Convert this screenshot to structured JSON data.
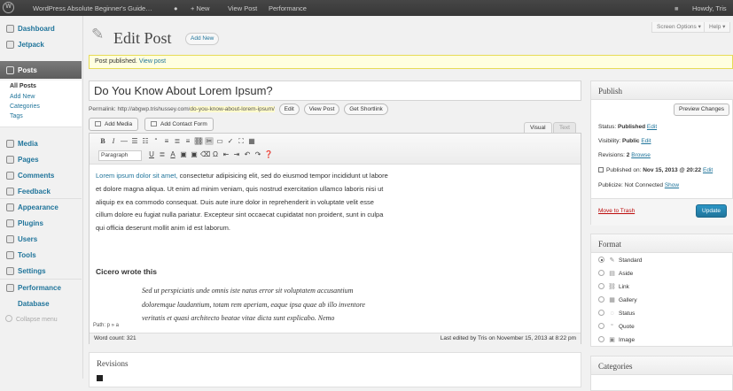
{
  "admin_bar": {
    "site_name": "WordPress Absolute Beginner's Guide…",
    "comment_icon": "speech-bubble-icon",
    "new_label": "+ New",
    "view_post": "View Post",
    "performance": "Performance",
    "howdy": "Howdy, Tris"
  },
  "sidebar": {
    "dashboard": "Dashboard",
    "jetpack": "Jetpack",
    "posts": "Posts",
    "sub": {
      "all_posts": "All Posts",
      "add_new": "Add New",
      "categories": "Categories",
      "tags": "Tags"
    },
    "media": "Media",
    "pages": "Pages",
    "comments": "Comments",
    "feedback": "Feedback",
    "appearance": "Appearance",
    "plugins": "Plugins",
    "users": "Users",
    "tools": "Tools",
    "settings": "Settings",
    "performance": "Performance",
    "database": "Database",
    "collapse": "Collapse menu"
  },
  "header": {
    "title": "Edit Post",
    "add_new": "Add New",
    "screen_options": "Screen Options ▾",
    "help": "Help ▾"
  },
  "notice": {
    "text": "Post published.",
    "link": "View post"
  },
  "post": {
    "title": "Do You Know About Lorem Ipsum?",
    "permalink_label": "Permalink:",
    "permalink_base": "http://abgwp.trishussey.com/",
    "permalink_slug": "do-you-know-about-lorem-ipsum/",
    "edit_btn": "Edit",
    "view_post_btn": "View Post",
    "shortlink_btn": "Get Shortlink"
  },
  "editor": {
    "add_media": "Add Media",
    "add_contact_form": "Add Contact Form",
    "tab_visual": "Visual",
    "tab_text": "Text",
    "paragraph": "Paragraph",
    "link_text": "Lorem ipsum dolor sit amet,",
    "body": " consectetur adipisicing elit, sed do eiusmod tempor incididunt ut labore et dolore magna aliqua. Ut enim ad minim veniam, quis nostrud exercitation ullamco laboris nisi ut aliquip ex ea commodo consequat. Duis aute irure dolor in reprehenderit in voluptate velit esse cillum dolore eu fugiat nulla pariatur. Excepteur sint occaecat cupidatat non proident, sunt in culpa qui officia deserunt mollit anim id est laborum.",
    "heading": "Cicero wrote this",
    "quote": "Sed ut perspiciatis unde omnis iste natus error sit voluptatem accusantium doloremque laudantium, totam rem aperiam, eaque ipsa quae ab illo inventore veritatis et quasi architecto beatae vitae dicta sunt explicabo. Nemo",
    "path": "Path: p » a",
    "word_count": "Word count: 321",
    "last_edited": "Last edited by Tris on November 15, 2013 at 8:22 pm"
  },
  "revisions": {
    "title": "Revisions"
  },
  "publish": {
    "title": "Publish",
    "preview_changes": "Preview Changes",
    "status_label": "Status:",
    "status_value": "Published",
    "visibility_label": "Visibility:",
    "visibility_value": "Public",
    "revisions_label": "Revisions:",
    "revisions_value": "2",
    "browse": "Browse",
    "published_on_label": "Published on:",
    "published_on_value": "Nov 15, 2013 @ 20:22",
    "publicize": "Publicize: Not Connected",
    "show": "Show",
    "edit": "Edit",
    "move_to_trash": "Move to Trash",
    "update": "Update"
  },
  "format": {
    "title": "Format",
    "options": [
      "Standard",
      "Aside",
      "Link",
      "Gallery",
      "Status",
      "Quote",
      "Image"
    ],
    "selected": "Standard"
  },
  "categories": {
    "title": "Categories"
  },
  "colors": {
    "accent": "#21759b",
    "notice_bg": "#ffffe0",
    "trash": "#bc0b0b"
  }
}
